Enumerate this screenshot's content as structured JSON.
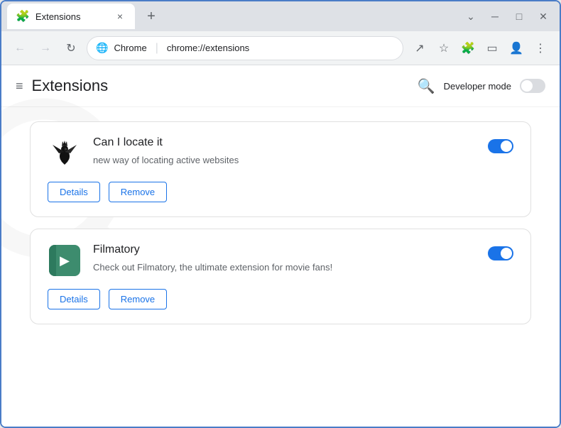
{
  "browser": {
    "tab_title": "Extensions",
    "tab_close_label": "×",
    "new_tab_label": "+",
    "window_minimize": "─",
    "window_maximize": "□",
    "window_close": "✕",
    "collapse_icon": "⌄"
  },
  "toolbar": {
    "back_label": "←",
    "forward_label": "→",
    "refresh_label": "↻",
    "chrome_label": "Chrome",
    "address_separator": "|",
    "url": "chrome://extensions",
    "share_label": "↗",
    "bookmark_label": "☆",
    "extensions_label": "🧩",
    "sidebar_label": "▭",
    "profile_label": "👤",
    "menu_label": "⋮"
  },
  "page": {
    "menu_icon": "≡",
    "title": "Extensions",
    "search_icon": "🔍",
    "developer_mode_label": "Developer mode"
  },
  "extensions": [
    {
      "name": "Can I locate it",
      "description": "new way of locating active websites",
      "details_label": "Details",
      "remove_label": "Remove",
      "enabled": true,
      "icon_type": "locate"
    },
    {
      "name": "Filmatory",
      "description": "Check out Filmatory, the ultimate extension for movie fans!",
      "details_label": "Details",
      "remove_label": "Remove",
      "enabled": true,
      "icon_type": "filmatory"
    }
  ]
}
